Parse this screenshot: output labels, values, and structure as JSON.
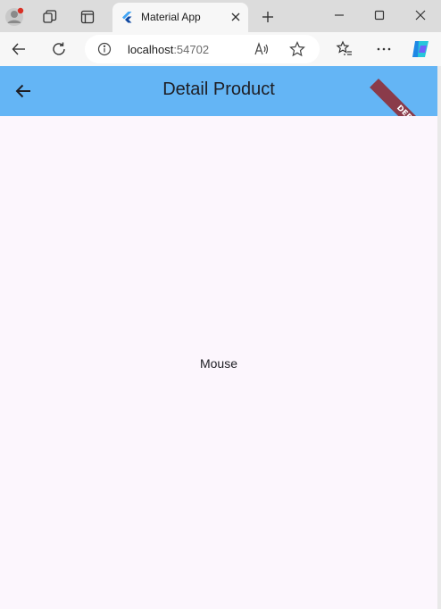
{
  "browser": {
    "tab_title": "Material App",
    "address_host": "localhost",
    "address_port": ":54702",
    "colors": {
      "tabstrip": "#dcdcdc",
      "toolbar": "#f7f7f7"
    }
  },
  "icons": {
    "profile": "profile-avatar-icon",
    "workspaces": "workspaces-icon",
    "vertical_tabs": "tab-actions-icon",
    "favicon": "flutter-logo-icon",
    "tab_close": "close-icon",
    "new_tab": "plus-icon",
    "minimize": "minimize-icon",
    "maximize": "maximize-icon",
    "window_close": "close-icon",
    "back": "back-arrow-icon",
    "refresh": "refresh-icon",
    "site_info": "info-icon",
    "read_aloud": "read-aloud-icon",
    "favorite": "star-icon",
    "favorites": "favorites-list-icon",
    "more": "more-dots-icon",
    "copilot": "copilot-icon",
    "app_back": "arrow-back-icon"
  },
  "app": {
    "title": "Detail Product",
    "product_name": "Mouse",
    "debug_label": "DEBUG",
    "colors": {
      "appbar": "#64b5f5",
      "background": "#fcf6fd",
      "debug_banner": "#8a3b4a"
    }
  }
}
